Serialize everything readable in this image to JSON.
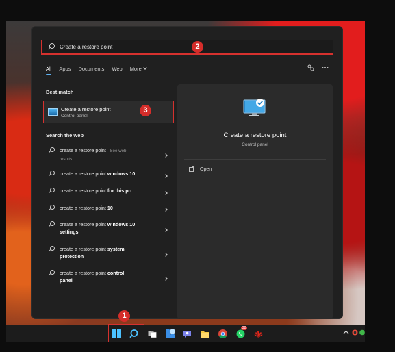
{
  "search": {
    "query": "Create a restore point"
  },
  "tabs": [
    {
      "label": "All",
      "active": true
    },
    {
      "label": "Apps",
      "active": false
    },
    {
      "label": "Documents",
      "active": false
    },
    {
      "label": "Web",
      "active": false
    },
    {
      "label": "More",
      "active": false
    }
  ],
  "sections": {
    "best_match": "Best match",
    "search_web": "Search the web"
  },
  "best_match": {
    "title": "Create a restore point",
    "subtitle": "Control panel"
  },
  "web_results": [
    {
      "text": "create a restore point",
      "suffix": " - See web",
      "line2": "results"
    },
    {
      "text": "create a restore point ",
      "bold": "windows 10"
    },
    {
      "text": "create a restore point ",
      "bold": "for this pc"
    },
    {
      "text": "create a restore point ",
      "bold": "10"
    },
    {
      "text": "create a restore point ",
      "bold": "windows 10",
      "line2_bold": "settings"
    },
    {
      "text": "create a restore point ",
      "bold": "system",
      "line2_bold": "protection"
    },
    {
      "text": "create a restore point ",
      "bold": "control",
      "line2_bold": "panel"
    }
  ],
  "preview": {
    "title": "Create a restore point",
    "subtitle": "Control panel",
    "action_open": "Open"
  },
  "annotations": [
    "1",
    "2",
    "3"
  ],
  "taskbar": {
    "whatsapp_badge": "38"
  },
  "colors": {
    "accent_red": "#d6312e",
    "tab_underline": "#5fb2f2",
    "panel_bg": "#202020"
  }
}
